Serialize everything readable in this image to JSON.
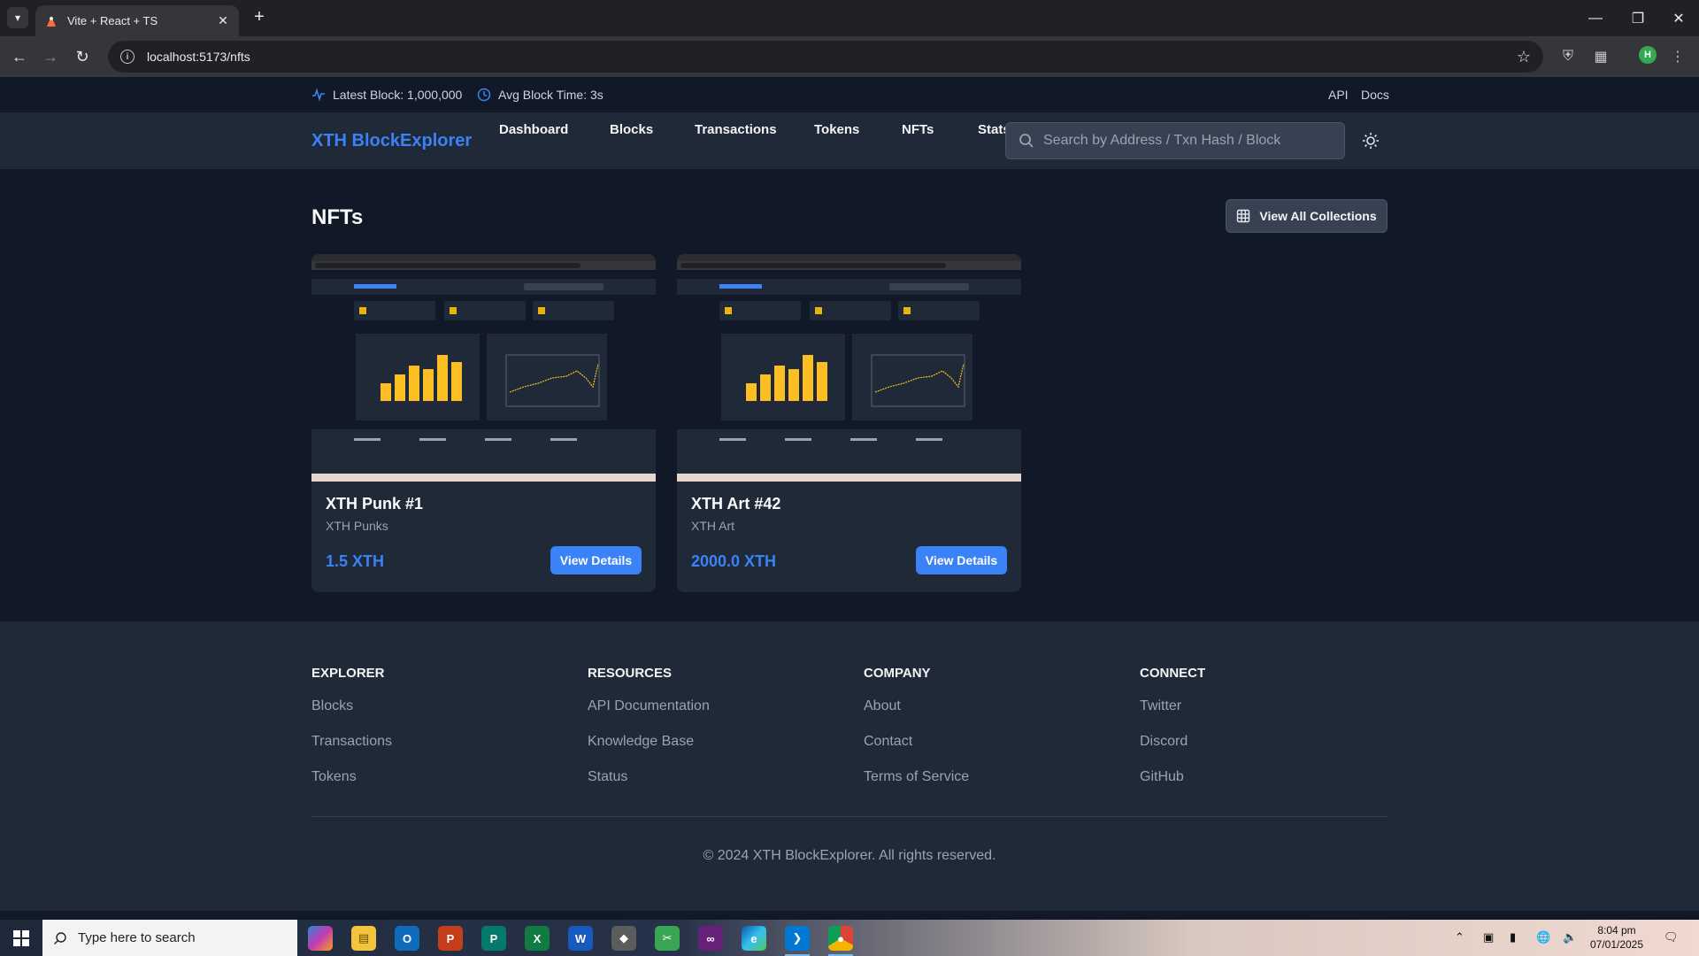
{
  "browser": {
    "tab_title": "Vite + React + TS",
    "url": "localhost:5173/nfts"
  },
  "topbar": {
    "latest_block": "Latest Block: 1,000,000",
    "avg_block_time": "Avg Block Time: 3s",
    "links": [
      "API",
      "Docs"
    ]
  },
  "header": {
    "brand": "XTH BlockExplorer",
    "nav": [
      "Dashboard",
      "Blocks",
      "Transactions",
      "Tokens",
      "NFTs",
      "Stats"
    ],
    "search_placeholder": "Search by Address / Txn Hash / Block"
  },
  "page": {
    "title": "NFTs",
    "view_all_label": "View All Collections"
  },
  "nfts": [
    {
      "name": "XTH Punk #1",
      "collection": "XTH Punks",
      "price": "1.5 XTH",
      "button": "View Details"
    },
    {
      "name": "XTH Art #42",
      "collection": "XTH Art",
      "price": "2000.0 XTH",
      "button": "View Details"
    }
  ],
  "footer": {
    "columns": [
      {
        "heading": "EXPLORER",
        "links": [
          "Blocks",
          "Transactions",
          "Tokens"
        ]
      },
      {
        "heading": "RESOURCES",
        "links": [
          "API Documentation",
          "Knowledge Base",
          "Status"
        ]
      },
      {
        "heading": "COMPANY",
        "links": [
          "About",
          "Contact",
          "Terms of Service"
        ]
      },
      {
        "heading": "CONNECT",
        "links": [
          "Twitter",
          "Discord",
          "GitHub"
        ]
      }
    ],
    "copyright": "© 2024 XTH BlockExplorer. All rights reserved."
  },
  "taskbar": {
    "search_placeholder": "Type here to search",
    "time": "8:04 pm",
    "date": "07/01/2025"
  },
  "colors": {
    "accent": "#3b82f6",
    "bg": "#111827",
    "surface": "#1f2937"
  }
}
